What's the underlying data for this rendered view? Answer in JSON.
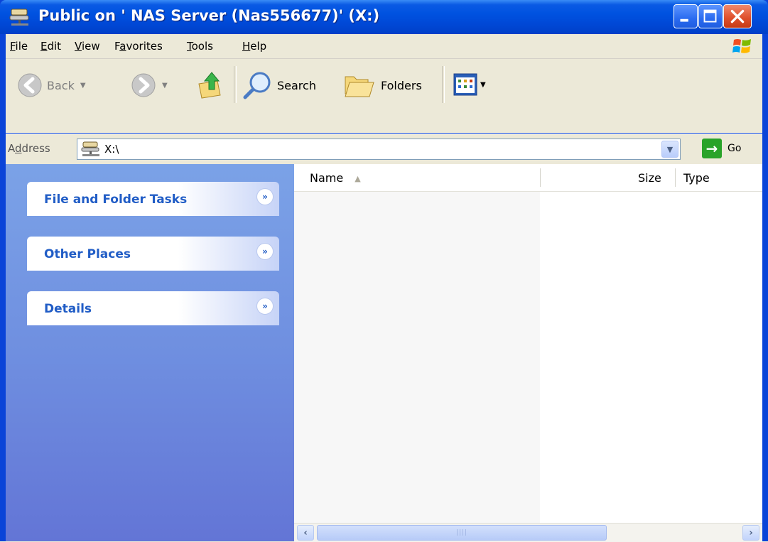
{
  "window": {
    "title": "Public on ' NAS Server (Nas556677)' (X:)",
    "icon": "network-drive-icon"
  },
  "menubar": {
    "items": [
      {
        "accel": "F",
        "rest": "ile"
      },
      {
        "accel": "E",
        "rest": "dit"
      },
      {
        "accel": "V",
        "rest": "iew"
      },
      {
        "pre": "F",
        "accel": "a",
        "rest": "vorites"
      },
      {
        "accel": "T",
        "rest": "ools"
      },
      {
        "accel": "H",
        "rest": "elp"
      }
    ]
  },
  "toolbar": {
    "back_label": "Back",
    "search_label": "Search",
    "folders_label": "Folders"
  },
  "address": {
    "label_accel": "d",
    "label_pre": "A",
    "label_rest": "dress",
    "value": "X:\\",
    "go_label": "Go"
  },
  "taskpane": {
    "panels": [
      {
        "title": "File and Folder Tasks"
      },
      {
        "title": "Other Places"
      },
      {
        "title": "Details"
      }
    ]
  },
  "filelist": {
    "columns": [
      "Name",
      "Size",
      "Type"
    ],
    "sorted_by": "Name"
  },
  "colors": {
    "titlebar": "#0052e0",
    "taskpane_top": "#7ba2e7",
    "panel_title": "#215dc6",
    "close_button": "#e0522e"
  }
}
